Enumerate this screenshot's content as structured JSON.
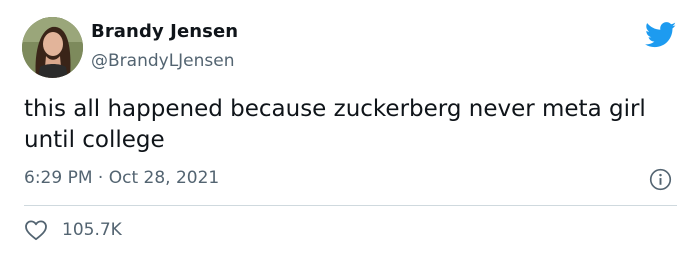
{
  "tweet": {
    "author_name": "Brandy Jensen",
    "author_handle": "@BrandyLJensen",
    "text": "this all happened because zuckerberg never meta girl until college",
    "time": "6:29 PM",
    "separator": "·",
    "date": "Oct 28, 2021",
    "likes": "105.7K"
  },
  "icons": {
    "logo": "twitter-bird-icon",
    "info": "info-icon",
    "like": "heart-icon"
  },
  "colors": {
    "twitter_blue": "#1d9bf0",
    "text_primary": "#0f1419",
    "text_secondary": "#536471",
    "divider": "#cfd9de"
  }
}
